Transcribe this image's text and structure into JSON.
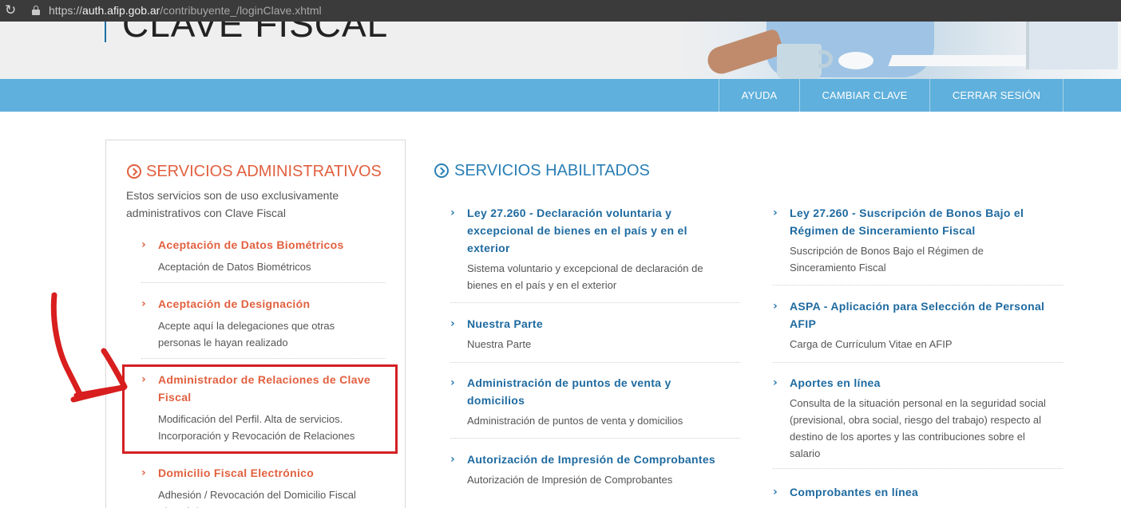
{
  "browser": {
    "url_protocol": "https://",
    "url_host": "auth.afip.gob.ar",
    "url_path": "/contribuyente_/loginClave.xhtml",
    "reload_icon": "reload-icon",
    "lock_icon": "lock-icon"
  },
  "header": {
    "brand_title": "CLAVE FISCAL"
  },
  "nav": {
    "items": [
      {
        "label": "AYUDA"
      },
      {
        "label": "CAMBIAR CLAVE"
      },
      {
        "label": "CERRAR SESIÓN"
      }
    ]
  },
  "admin": {
    "title": "SERVICIOS ADMINISTRATIVOS",
    "description": "Estos servicios son de uso exclusivamente administrativos con Clave Fiscal",
    "services": [
      {
        "name": "Aceptación de Datos Biométricos",
        "desc": "Aceptación de Datos Biométricos"
      },
      {
        "name": "Aceptación de Designación",
        "desc": "Acepte aquí la delegaciones que otras personas le hayan realizado"
      },
      {
        "name": "Administrador de Relaciones de Clave Fiscal",
        "desc": "Modificación del Perfil. Alta de servicios. Incorporación y Revocación de Relaciones"
      },
      {
        "name": "Domicilio Fiscal Electrónico",
        "desc": "Adhesión / Revocación del Domicilio Fiscal Electrónico"
      }
    ]
  },
  "enabled": {
    "title": "SERVICIOS HABILITADOS",
    "col1": [
      {
        "name": "Ley 27.260 - Declaración voluntaria y excepcional de bienes en el país y en el exterior",
        "desc": "Sistema voluntario y excepcional de declaración de bienes en el país y en el exterior"
      },
      {
        "name": "Nuestra Parte",
        "desc": "Nuestra Parte"
      },
      {
        "name": "Administración de puntos de venta y domicilios",
        "desc": "Administración de puntos de venta y domicilios"
      },
      {
        "name": "Autorización de Impresión de Comprobantes",
        "desc": "Autorización de Impresión de Comprobantes"
      }
    ],
    "col2": [
      {
        "name": "Ley 27.260 - Suscripción de Bonos Bajo el Régimen de Sinceramiento Fiscal",
        "desc": "Suscripción de Bonos Bajo el Régimen de Sinceramiento Fiscal"
      },
      {
        "name": "ASPA - Aplicación para Selección de Personal AFIP",
        "desc": "Carga de Currículum Vitae en AFIP"
      },
      {
        "name": "Aportes en línea",
        "desc": "Consulta de la situación personal en la seguridad social (previsional, obra social, riesgo del trabajo) respecto al destino de los aportes y las contribuciones sobre el salario"
      },
      {
        "name": "Comprobantes en línea",
        "desc": ""
      }
    ]
  },
  "colors": {
    "nav_bg": "#5fb0dc",
    "admin_accent": "#e2603f",
    "enabled_accent": "#2a7fb5",
    "highlight_box": "#d32024"
  }
}
